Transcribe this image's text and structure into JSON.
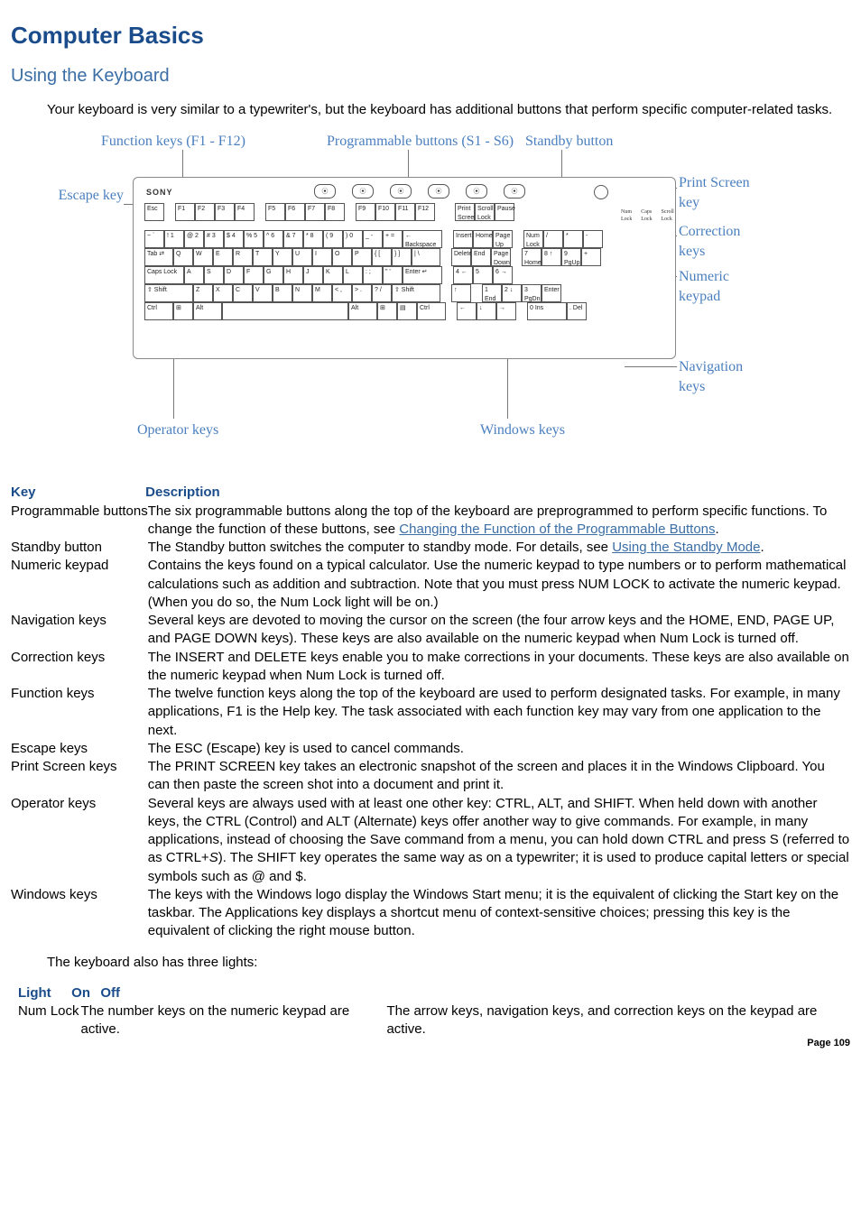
{
  "title": "Computer Basics",
  "subtitle": "Using the Keyboard",
  "intro": "Your keyboard is very similar to a typewriter's, but the keyboard has additional buttons that perform specific computer-related tasks.",
  "figure": {
    "brand": "SONY",
    "labels": {
      "function_keys": "Function keys (F1 - F12)",
      "programmable_buttons": "Programmable buttons (S1 - S6)",
      "standby_button": "Standby button",
      "escape_key": "Escape key",
      "print_screen_key": "Print Screen key",
      "correction_keys": "Correction keys",
      "numeric_keypad": "Numeric keypad",
      "navigation_keys": "Navigation keys",
      "operator_keys": "Operator keys",
      "windows_keys": "Windows keys"
    },
    "light_labels": [
      "Num Lock",
      "Caps Lock",
      "Scroll Lock"
    ],
    "rows": {
      "fn": [
        "Esc",
        "F1",
        "F2",
        "F3",
        "F4",
        "F5",
        "F6",
        "F7",
        "F8",
        "F9",
        "F10",
        "F11",
        "F12",
        "Print Screen",
        "Scroll Lock",
        "Pause"
      ],
      "num": [
        "~ `",
        "! 1",
        "@ 2",
        "# 3",
        "$ 4",
        "% 5",
        "^ 6",
        "& 7",
        "* 8",
        "( 9",
        ") 0",
        "_ -",
        "+ =",
        "← Backspace",
        "Insert",
        "Home",
        "Page Up",
        "Num Lock",
        "/",
        "*",
        "-"
      ],
      "qw": [
        "Tab ⇄",
        "Q",
        "W",
        "E",
        "R",
        "T",
        "Y",
        "U",
        "I",
        "O",
        "P",
        "{ [",
        "} ]",
        "| \\",
        "Delete",
        "End",
        "Page Down",
        "7 Home",
        "8 ↑",
        "9 PgUp",
        "+"
      ],
      "as": [
        "Caps Lock",
        "A",
        "S",
        "D",
        "F",
        "G",
        "H",
        "J",
        "K",
        "L",
        ": ;",
        "\" '",
        "Enter ↵",
        "4 ←",
        "5",
        "6 →"
      ],
      "zx": [
        "⇧ Shift",
        "Z",
        "X",
        "C",
        "V",
        "B",
        "N",
        "M",
        "< ,",
        "> .",
        "? /",
        "⇧ Shift",
        "↑",
        "1 End",
        "2 ↓",
        "3 PgDn",
        "Enter"
      ],
      "ctrl": [
        "Ctrl",
        "⊞",
        "Alt",
        "",
        "Alt",
        "⊞",
        "▤",
        "Ctrl",
        "←",
        "↓",
        "→",
        "0 Ins",
        ". Del"
      ]
    }
  },
  "table1": {
    "headers": [
      "Key",
      "Description"
    ],
    "rows": [
      {
        "key": "Programmable buttons",
        "desc_pre": "The six programmable buttons along the top of the keyboard are preprogrammed to perform specific functions. To change the function of these buttons, see ",
        "link": "Changing the Function of the Programmable Buttons",
        "desc_post": "."
      },
      {
        "key": "Standby button",
        "desc_pre": "The Standby button switches the computer to standby mode. For details, see ",
        "link": "Using the Standby Mode",
        "desc_post": "."
      },
      {
        "key": "Numeric keypad",
        "desc": "Contains the keys found on a typical calculator. Use the numeric keypad to type numbers or to perform mathematical calculations such as addition and subtraction. Note that you must press NUM LOCK to activate the numeric keypad. (When you do so, the Num Lock light will be on.)"
      },
      {
        "key": "Navigation keys",
        "desc": "Several keys are devoted to moving the cursor on the screen (the four arrow keys and the HOME, END, PAGE UP, and PAGE DOWN keys). These keys are also available on the numeric keypad when Num Lock is turned off."
      },
      {
        "key": "Correction keys",
        "desc": "The INSERT and DELETE keys enable you to make corrections in your documents. These keys are also available on the numeric keypad when Num Lock is turned off."
      },
      {
        "key": "Function keys",
        "desc": "The twelve function keys along the top of the keyboard are used to perform designated tasks. For example, in many applications, F1 is the Help key. The task associated with each function key may vary from one application to the next."
      },
      {
        "key": "Escape keys",
        "desc": "The ESC (Escape) key is used to cancel commands."
      },
      {
        "key": "Print Screen keys",
        "desc": "The PRINT SCREEN key takes an electronic snapshot of the screen and places it in the Windows Clipboard. You can then paste the screen shot into a document and print it."
      },
      {
        "key": "Operator keys",
        "desc_pre": "Several keys are always used with at least one other key: CTRL, ALT, and SHIFT. When held down with another keys, the CTRL (Control) and ALT (Alternate) keys offer another way to give commands. For example, in many applications, instead of choosing the Save command from a menu, you can hold down CTRL and press S (referred to as CTRL+",
        "italic": "S",
        "desc_post": "). The SHIFT key operates the same way as on a typewriter; it is used to produce capital letters or special symbols such as @ and $."
      },
      {
        "key": "Windows keys",
        "desc": "The keys with the Windows logo display the Windows Start menu; it is the equivalent of clicking the Start key on the taskbar. The Applications key displays a shortcut menu of context-sensitive choices; pressing this key is the equivalent of clicking the right mouse button."
      }
    ]
  },
  "outro": "The keyboard also has three lights:",
  "table2": {
    "headers": [
      "Light",
      "On",
      "Off"
    ],
    "rows": [
      {
        "light": "Num Lock",
        "on": "The number keys on the numeric keypad are active.",
        "off": "The arrow keys, navigation keys, and correction keys on the keypad are active."
      }
    ]
  },
  "page_footer": "Page 109"
}
